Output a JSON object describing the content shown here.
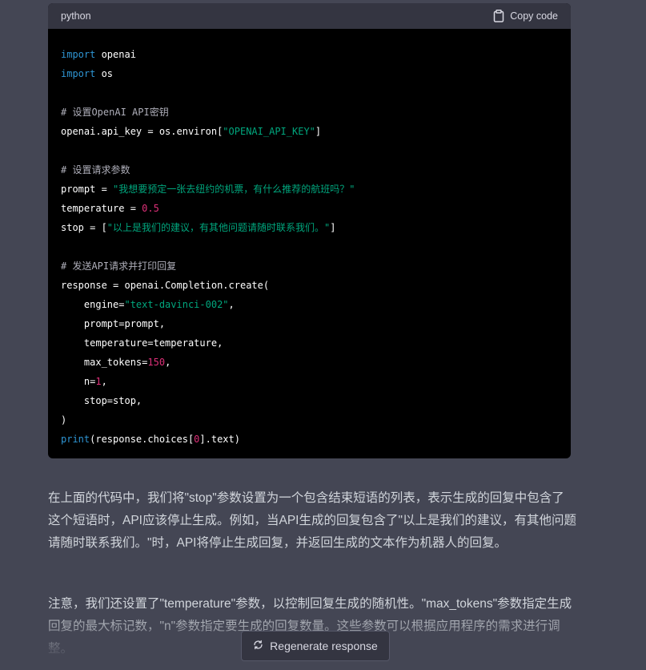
{
  "code_block": {
    "language": "python",
    "copy_label": "Copy code",
    "lines": [
      [
        {
          "t": "kw",
          "v": "import"
        },
        {
          "t": "",
          "v": " openai"
        }
      ],
      [
        {
          "t": "kw",
          "v": "import"
        },
        {
          "t": "",
          "v": " os"
        }
      ],
      [],
      [
        {
          "t": "cm",
          "v": "# 设置OpenAI API密钥"
        }
      ],
      [
        {
          "t": "",
          "v": "openai.api_key = os.environ["
        },
        {
          "t": "st",
          "v": "\"OPENAI_API_KEY\""
        },
        {
          "t": "",
          "v": "]"
        }
      ],
      [],
      [
        {
          "t": "cm",
          "v": "# 设置请求参数"
        }
      ],
      [
        {
          "t": "",
          "v": "prompt = "
        },
        {
          "t": "st",
          "v": "\"我想要预定一张去纽约的机票，有什么推荐的航班吗？\""
        }
      ],
      [
        {
          "t": "",
          "v": "temperature = "
        },
        {
          "t": "nm",
          "v": "0.5"
        }
      ],
      [
        {
          "t": "",
          "v": "stop = ["
        },
        {
          "t": "st",
          "v": "\"以上是我们的建议，有其他问题请随时联系我们。\""
        },
        {
          "t": "",
          "v": "]"
        }
      ],
      [],
      [
        {
          "t": "cm",
          "v": "# 发送API请求并打印回复"
        }
      ],
      [
        {
          "t": "",
          "v": "response = openai.Completion.create("
        }
      ],
      [
        {
          "t": "",
          "v": "    engine="
        },
        {
          "t": "st",
          "v": "\"text-davinci-002\""
        },
        {
          "t": "",
          "v": ","
        }
      ],
      [
        {
          "t": "",
          "v": "    prompt=prompt,"
        }
      ],
      [
        {
          "t": "",
          "v": "    temperature=temperature,"
        }
      ],
      [
        {
          "t": "",
          "v": "    max_tokens="
        },
        {
          "t": "nm",
          "v": "150"
        },
        {
          "t": "",
          "v": ","
        }
      ],
      [
        {
          "t": "",
          "v": "    n="
        },
        {
          "t": "nm",
          "v": "1"
        },
        {
          "t": "",
          "v": ","
        }
      ],
      [
        {
          "t": "",
          "v": "    stop=stop,"
        }
      ],
      [
        {
          "t": "",
          "v": ")"
        }
      ],
      [
        {
          "t": "kw",
          "v": "print"
        },
        {
          "t": "",
          "v": "(response.choices["
        },
        {
          "t": "nm",
          "v": "0"
        },
        {
          "t": "",
          "v": "].text)"
        }
      ]
    ]
  },
  "prose": {
    "paragraph1": "在上面的代码中，我们将\"stop\"参数设置为一个包含结束短语的列表，表示生成的回复中包含了这个短语时，API应该停止生成。例如，当API生成的回复包含了\"以上是我们的建议，有其他问题请随时联系我们。\"时，API将停止生成回复，并返回生成的文本作为机器人的回复。",
    "paragraph2": "注意，我们还设置了\"temperature\"参数，以控制回复生成的随机性。\"max_tokens\"参数指定生成回复的最大标记数，\"n\"参数指定要生成的回复数量。这些参数可以根据应用程序的需求进行调整。"
  },
  "regenerate": {
    "label": "Regenerate response",
    "icon": "refresh-icon"
  },
  "colors": {
    "background": "#444654",
    "code_bg": "#000000",
    "code_header": "#343541",
    "keyword": "#2e95d3",
    "string": "#00a67d",
    "number": "#df3079",
    "comment": "#aeaeb9"
  }
}
